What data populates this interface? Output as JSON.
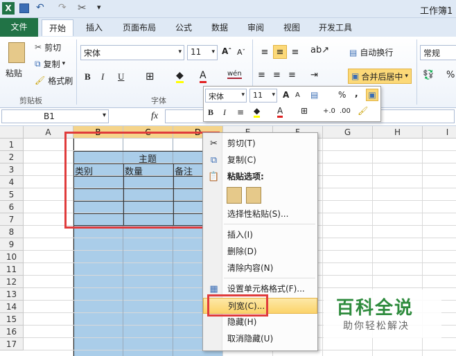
{
  "window": {
    "title": "工作簿1"
  },
  "ribbon_tabs": [
    "文件",
    "开始",
    "插入",
    "页面布局",
    "公式",
    "数据",
    "审阅",
    "视图",
    "开发工具"
  ],
  "clipboard": {
    "paste": "粘贴",
    "cut": "剪切",
    "copy": "复制",
    "format_painter": "格式刷",
    "group_label": "剪贴板"
  },
  "font": {
    "name": "宋体",
    "size": "11",
    "group_label": "字体",
    "bold": "B",
    "italic": "I",
    "underline": "U",
    "phonetic": "wén"
  },
  "alignment": {
    "wrap": "自动换行",
    "merge": "合并后居中"
  },
  "number": {
    "format": "常规",
    "percent": "%"
  },
  "formula_bar": {
    "cell_ref": "B1",
    "fx": "fx"
  },
  "columns": [
    "A",
    "B",
    "C",
    "D",
    "E",
    "F",
    "G",
    "H",
    "I"
  ],
  "rows": [
    "1",
    "2",
    "3",
    "4",
    "5",
    "6",
    "7",
    "8",
    "9",
    "10",
    "11",
    "12",
    "13",
    "14",
    "15",
    "16",
    "17"
  ],
  "cells": {
    "title": "主题",
    "h1": "类别",
    "h2": "数量",
    "h3": "备注"
  },
  "minibar": {
    "font": "宋体",
    "size": "11"
  },
  "context_menu": {
    "items": [
      "剪切(T)",
      "复制(C)",
      "粘贴选项:",
      "选择性粘贴(S)...",
      "插入(I)",
      "删除(D)",
      "清除内容(N)",
      "设置单元格格式(F)...",
      "列宽(C)...",
      "隐藏(H)",
      "取消隐藏(U)"
    ]
  },
  "watermark": {
    "title": "百科全说",
    "subtitle": "助你轻松解决"
  },
  "colors": {
    "file_tab": "#217346",
    "selection": "#aacde9",
    "highlight_box": "#e03b3b",
    "menu_hover": "#fbd36a"
  }
}
